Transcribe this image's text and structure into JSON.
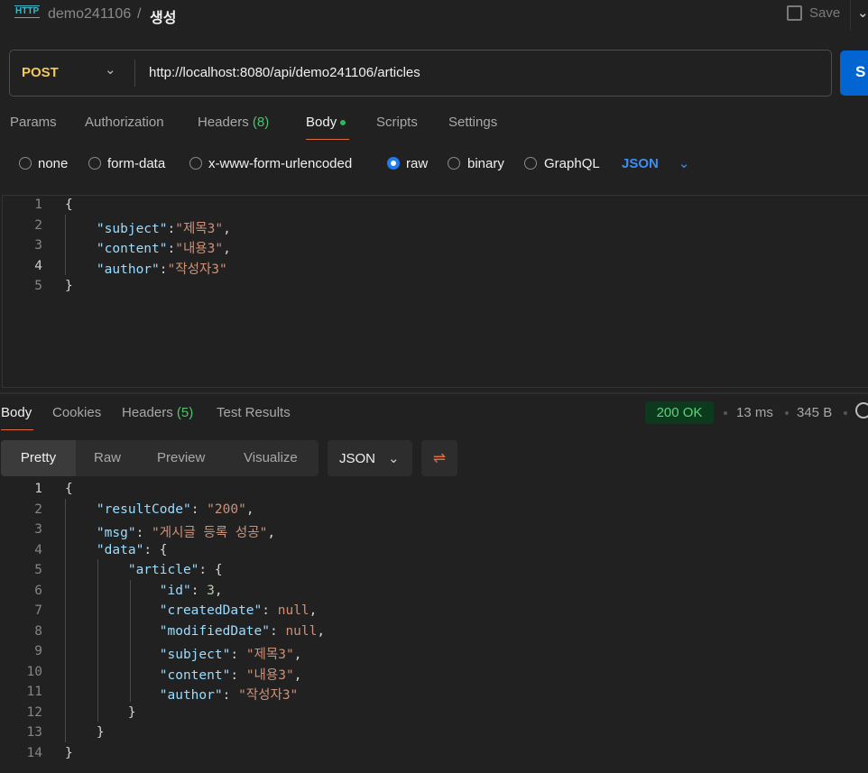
{
  "header": {
    "icon": "http-icon",
    "collection": "demo241106",
    "separator": "/",
    "request_name": "생성",
    "save_label": "Save"
  },
  "request": {
    "method": "POST",
    "url": "http://localhost:8080/api/demo241106/articles",
    "send_label": "S"
  },
  "request_tabs": [
    {
      "label": "Params"
    },
    {
      "label": "Authorization"
    },
    {
      "label": "Headers",
      "count": "(8)"
    },
    {
      "label": "Body",
      "active": true
    },
    {
      "label": "Scripts"
    },
    {
      "label": "Settings"
    }
  ],
  "body_types": [
    {
      "label": "none"
    },
    {
      "label": "form-data"
    },
    {
      "label": "x-www-form-urlencoded"
    },
    {
      "label": "raw",
      "selected": true
    },
    {
      "label": "binary"
    },
    {
      "label": "GraphQL"
    }
  ],
  "body_format": "JSON",
  "request_body": [
    [
      [
        "p",
        "{"
      ]
    ],
    [
      [
        "p",
        "    "
      ],
      [
        "k",
        "\"subject\""
      ],
      [
        "p",
        ":"
      ],
      [
        "s",
        "\"제목3\""
      ],
      [
        "p",
        ","
      ]
    ],
    [
      [
        "p",
        "    "
      ],
      [
        "k",
        "\"content\""
      ],
      [
        "p",
        ":"
      ],
      [
        "s",
        "\"내용3\""
      ],
      [
        "p",
        ","
      ]
    ],
    [
      [
        "p",
        "    "
      ],
      [
        "k",
        "\"author\""
      ],
      [
        "p",
        ":"
      ],
      [
        "s",
        "\"작성자3\""
      ]
    ],
    [
      [
        "p",
        "}"
      ]
    ]
  ],
  "response_tabs": [
    {
      "label": "Body",
      "active": true
    },
    {
      "label": "Cookies"
    },
    {
      "label": "Headers",
      "count": "(5)"
    },
    {
      "label": "Test Results"
    }
  ],
  "response_status": {
    "code": "200 OK",
    "time": "13 ms",
    "size": "345 B"
  },
  "view_modes": [
    {
      "label": "Pretty",
      "active": true
    },
    {
      "label": "Raw"
    },
    {
      "label": "Preview"
    },
    {
      "label": "Visualize"
    }
  ],
  "response_format": "JSON",
  "response_body": [
    [
      [
        "p",
        "{"
      ]
    ],
    [
      [
        "p",
        "    "
      ],
      [
        "k",
        "\"resultCode\""
      ],
      [
        "p",
        ": "
      ],
      [
        "s",
        "\"200\""
      ],
      [
        "p",
        ","
      ]
    ],
    [
      [
        "p",
        "    "
      ],
      [
        "k",
        "\"msg\""
      ],
      [
        "p",
        ": "
      ],
      [
        "s",
        "\"게시글 등록 성공\""
      ],
      [
        "p",
        ","
      ]
    ],
    [
      [
        "p",
        "    "
      ],
      [
        "k",
        "\"data\""
      ],
      [
        "p",
        ": {"
      ]
    ],
    [
      [
        "p",
        "        "
      ],
      [
        "k",
        "\"article\""
      ],
      [
        "p",
        ": {"
      ]
    ],
    [
      [
        "p",
        "            "
      ],
      [
        "k",
        "\"id\""
      ],
      [
        "p",
        ": "
      ],
      [
        "n",
        "3"
      ],
      [
        "p",
        ","
      ]
    ],
    [
      [
        "p",
        "            "
      ],
      [
        "k",
        "\"createdDate\""
      ],
      [
        "p",
        ": "
      ],
      [
        "z",
        "null"
      ],
      [
        "p",
        ","
      ]
    ],
    [
      [
        "p",
        "            "
      ],
      [
        "k",
        "\"modifiedDate\""
      ],
      [
        "p",
        ": "
      ],
      [
        "z",
        "null"
      ],
      [
        "p",
        ","
      ]
    ],
    [
      [
        "p",
        "            "
      ],
      [
        "k",
        "\"subject\""
      ],
      [
        "p",
        ": "
      ],
      [
        "s",
        "\"제목3\""
      ],
      [
        "p",
        ","
      ]
    ],
    [
      [
        "p",
        "            "
      ],
      [
        "k",
        "\"content\""
      ],
      [
        "p",
        ": "
      ],
      [
        "s",
        "\"내용3\""
      ],
      [
        "p",
        ","
      ]
    ],
    [
      [
        "p",
        "            "
      ],
      [
        "k",
        "\"author\""
      ],
      [
        "p",
        ": "
      ],
      [
        "s",
        "\"작성자3\""
      ]
    ],
    [
      [
        "p",
        "        }"
      ]
    ],
    [
      [
        "p",
        "    }"
      ]
    ],
    [
      [
        "p",
        "}"
      ]
    ]
  ],
  "colors": {
    "accent_tab": "#e06c3d",
    "send": "#0265d2",
    "method": "#f4c85a",
    "status_bg": "#0c3a1d",
    "status_text": "#5ed17f"
  }
}
